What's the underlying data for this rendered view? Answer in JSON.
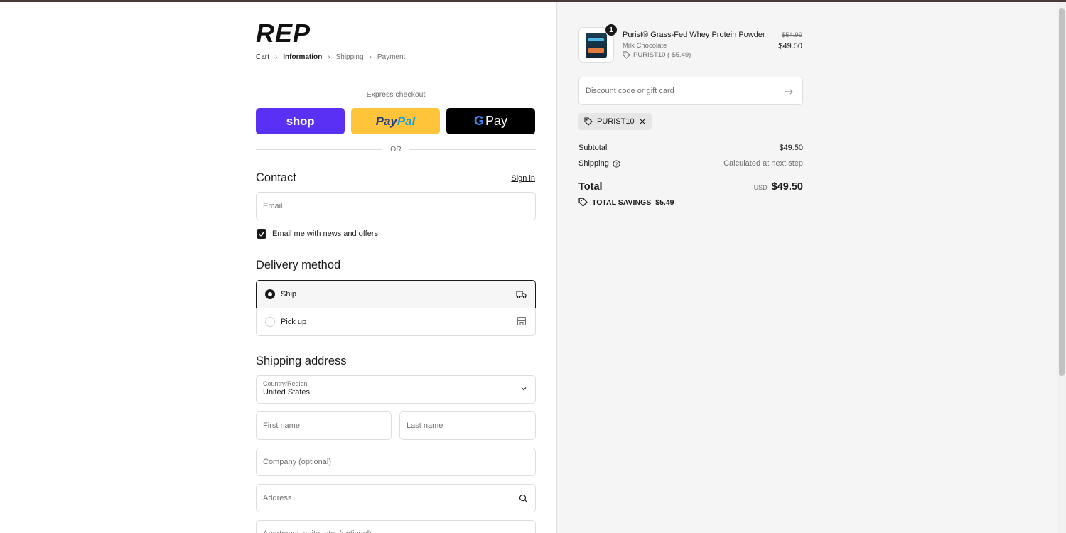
{
  "brand": {
    "logo_text": "REP"
  },
  "breadcrumb": [
    {
      "label": "Cart"
    },
    {
      "label": "Information"
    },
    {
      "label": "Shipping"
    },
    {
      "label": "Payment"
    }
  ],
  "express": {
    "label": "Express checkout",
    "shop_label": "shop",
    "paypal_a": "Pay",
    "paypal_b": "Pal",
    "gpay_g": "G",
    "gpay_label": "Pay",
    "or_label": "OR"
  },
  "contact": {
    "heading": "Contact",
    "sign_in": "Sign in",
    "email_placeholder": "Email",
    "newsletter_label": "Email me with news and offers",
    "newsletter_checked": true
  },
  "delivery": {
    "heading": "Delivery method",
    "options": [
      {
        "label": "Ship",
        "icon": "truck-icon",
        "selected": true
      },
      {
        "label": "Pick up",
        "icon": "store-icon",
        "selected": false
      }
    ]
  },
  "shipping": {
    "heading": "Shipping address",
    "country_label": "Country/Region",
    "country_value": "United States",
    "first_name_placeholder": "First name",
    "last_name_placeholder": "Last name",
    "company_placeholder": "Company (optional)",
    "address_placeholder": "Address",
    "apartment_placeholder": "Apartment, suite, etc. (optional)"
  },
  "summary": {
    "product": {
      "name": "Purist® Grass-Fed Whey Protein Powder",
      "variant": "Milk Chocolate",
      "discount": "PURIST10 (-$5.49)",
      "old_price": "$54.99",
      "price": "$49.50",
      "quantity": "1"
    },
    "discount_placeholder": "Discount code or gift card",
    "applied_code": "PURIST10",
    "subtotal_label": "Subtotal",
    "subtotal_value": "$49.50",
    "shipping_label": "Shipping",
    "shipping_value": "Calculated at next step",
    "total_label": "Total",
    "currency": "USD",
    "total_value": "$49.50",
    "savings_label": "TOTAL SAVINGS",
    "savings_value": "$5.49"
  },
  "colors": {
    "shop_pay": "#5a31f4",
    "paypal": "#ffc439",
    "gpay": "#000000",
    "summary_bg": "#f5f5f5"
  }
}
